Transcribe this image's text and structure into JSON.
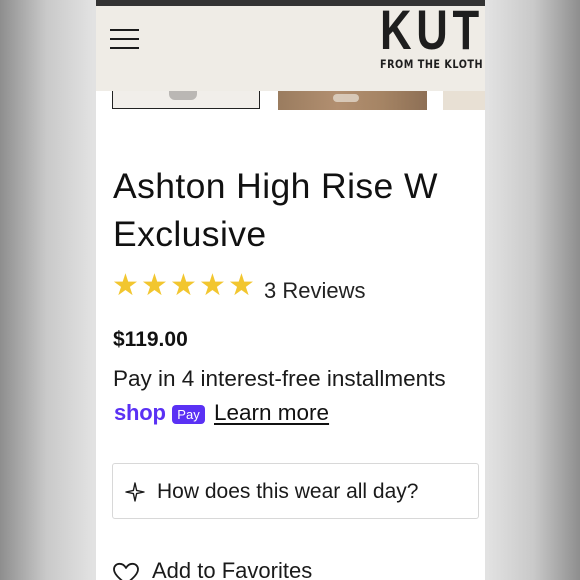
{
  "header": {
    "menu_icon": "hamburger-menu-icon",
    "logo_text": "KUT",
    "logo_subtext": "FROM THE KLOTH"
  },
  "product": {
    "title_line1": "Ashton High Rise W",
    "title_line2": "Exclusive",
    "rating": 5,
    "rating_max": 5,
    "reviews_label": "3 Reviews",
    "price": "$119.00"
  },
  "payment": {
    "installments_text": "Pay in 4 interest-free installments",
    "shop_word": "shop",
    "pay_badge": "Pay",
    "learn_more": "Learn more"
  },
  "ask": {
    "icon": "sparkle-icon",
    "label": "How does this wear all day?"
  },
  "favorites": {
    "icon": "heart-icon",
    "label": "Add to Favorites"
  },
  "colors": {
    "star": "#f2c62f",
    "shop_pay": "#5a31f4",
    "header_bg": "#efece6"
  }
}
